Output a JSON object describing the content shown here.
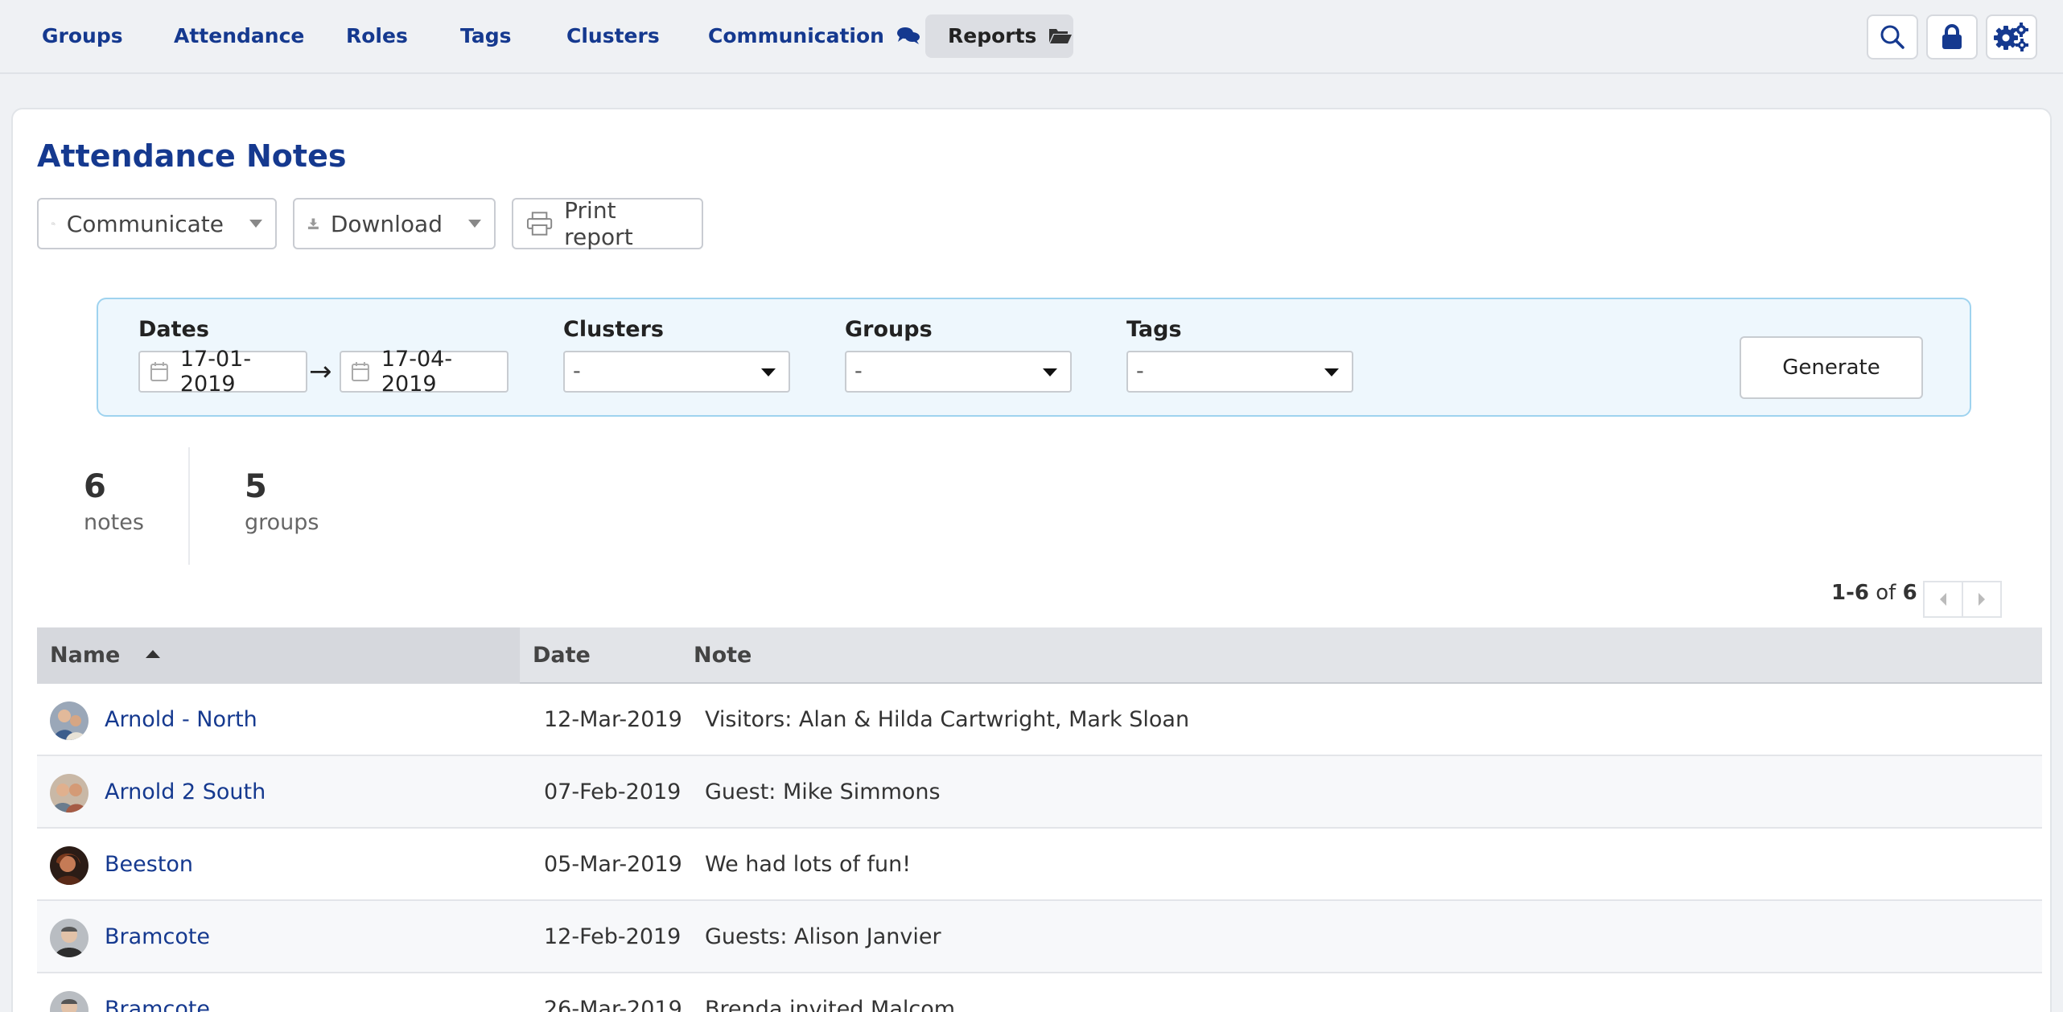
{
  "nav": {
    "items": [
      {
        "label": "Groups"
      },
      {
        "label": "Attendance"
      },
      {
        "label": "Roles"
      },
      {
        "label": "Tags"
      },
      {
        "label": "Clusters"
      },
      {
        "label": "Communication"
      },
      {
        "label": "Reports"
      }
    ],
    "active": "Reports",
    "icons": [
      "search-icon",
      "lock-icon",
      "settings-icon"
    ]
  },
  "page": {
    "title": "Attendance Notes"
  },
  "toolbar": {
    "communicate_label": "Communicate",
    "download_label": "Download",
    "print_label": "Print report"
  },
  "filters": {
    "dates_label": "Dates",
    "date_from": "17-01-2019",
    "date_arrow": "→",
    "date_to": "17-04-2019",
    "clusters_label": "Clusters",
    "clusters_value": "-",
    "groups_label": "Groups",
    "groups_value": "-",
    "tags_label": "Tags",
    "tags_value": "-",
    "generate_label": "Generate"
  },
  "stats": {
    "notes_count": "6",
    "notes_label": "notes",
    "groups_count": "5",
    "groups_label": "groups"
  },
  "pagination": {
    "range": "1-6",
    "of_label": "of",
    "total": "6"
  },
  "table": {
    "columns": {
      "name": "Name",
      "date": "Date",
      "note": "Note"
    },
    "rows": [
      {
        "name": "Arnold - North",
        "date": "12-Mar-2019",
        "note": "Visitors: Alan & Hilda Cartwright, Mark Sloan"
      },
      {
        "name": "Arnold 2 South",
        "date": "07-Feb-2019",
        "note": "Guest: Mike Simmons"
      },
      {
        "name": "Beeston",
        "date": "05-Mar-2019",
        "note": "We had lots of fun!"
      },
      {
        "name": "Bramcote",
        "date": "12-Feb-2019",
        "note": "Guests: Alison Janvier"
      },
      {
        "name": "Bramcote",
        "date": "26-Mar-2019",
        "note": "Brenda invited Malcom"
      }
    ]
  },
  "colors": {
    "brand_blue": "#15398f",
    "filter_bg": "#eef7fd",
    "filter_border": "#9fd3ef"
  }
}
